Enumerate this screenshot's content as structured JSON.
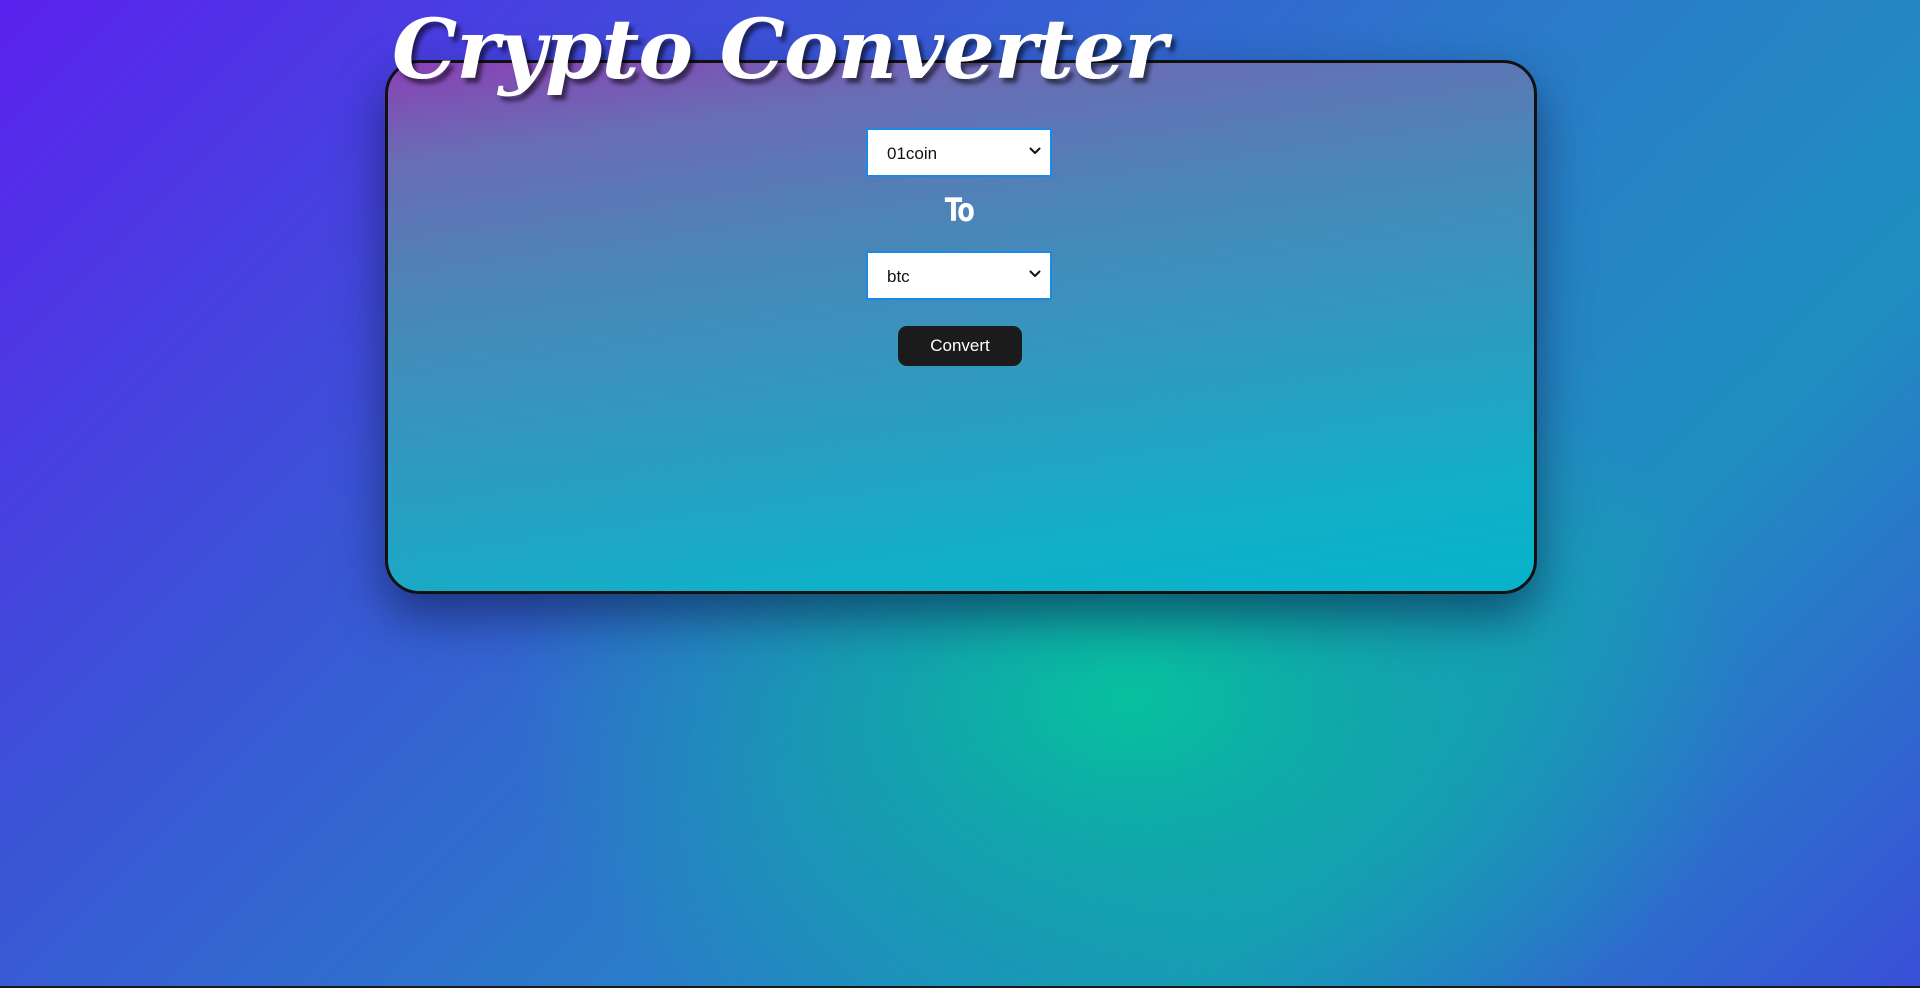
{
  "app": {
    "title": "Crypto Converter"
  },
  "converter": {
    "from_currency": "01coin",
    "separator_label": "To",
    "to_currency": "btc",
    "convert_label": "Convert"
  },
  "icons": {
    "select_arrow": "chevron-down-icon"
  },
  "colors": {
    "background_start": "#5b22ee",
    "background_glow": "#06c49c",
    "card_top": "#8a40b6",
    "card_bottom": "#07b2cb",
    "select_border": "#1e88e5",
    "button_bg": "#1b1b1b"
  }
}
